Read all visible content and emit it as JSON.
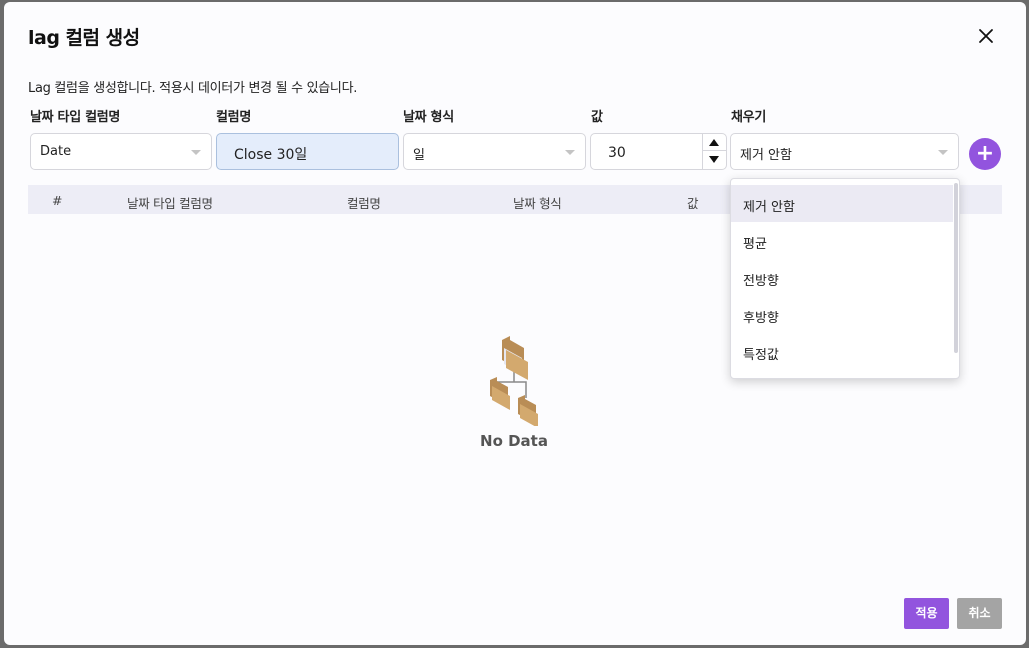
{
  "dialog": {
    "title": "lag 컬럼 생성",
    "description": "Lag 컬럼을 생성합니다. 적용시 데이터가 변경 될 수 있습니다."
  },
  "form": {
    "labels": {
      "date_column": "날짜 타입 컬럼명",
      "column_name": "컬럼명",
      "date_format": "날짜 형식",
      "value": "값",
      "fill": "채우기"
    },
    "date_column_value": "Date",
    "column_name_value": "Close 30일",
    "date_format_value": "일",
    "value_value": "30",
    "fill_value": "제거 안함",
    "add_label": "+"
  },
  "table": {
    "headers": [
      "#",
      "날짜 타입 컬럼명",
      "컬럼명",
      "날짜 형식",
      "값"
    ],
    "rows": [],
    "empty_text": "No Data"
  },
  "fill_dropdown": {
    "options": [
      "제거 안함",
      "평균",
      "전방향",
      "후방향",
      "특정값"
    ],
    "selected": "제거 안함"
  },
  "footer": {
    "apply_label": "적용",
    "cancel_label": "취소"
  },
  "colors": {
    "accent": "#9254de",
    "cancel": "#a4a4a4",
    "header_bg": "#ededf6",
    "column_name_bg": "#e4edfb"
  },
  "icons": {
    "close": "close-icon",
    "empty": "folder-tree-icon",
    "spinner_up": "triangle-up-icon",
    "spinner_down": "triangle-down-icon"
  }
}
